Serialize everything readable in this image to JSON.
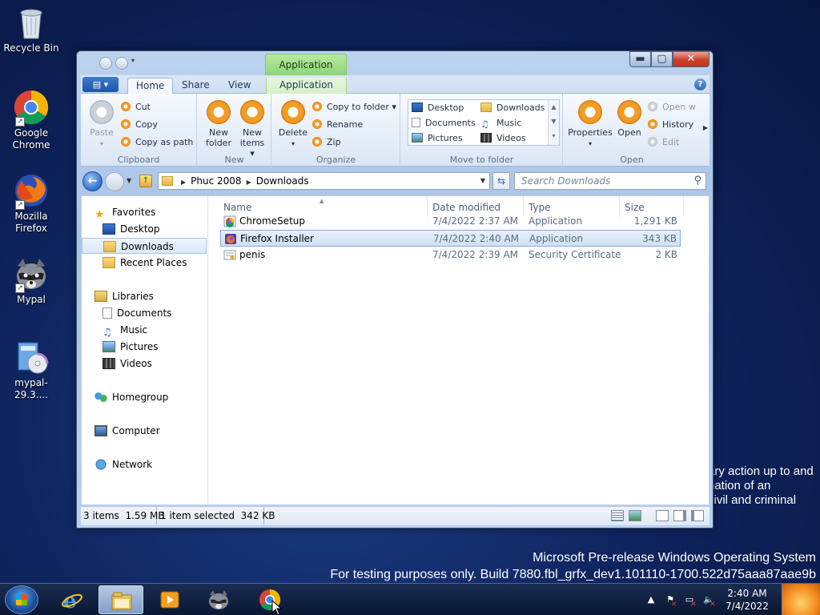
{
  "desktop": {
    "icons": [
      {
        "label": "Recycle Bin",
        "icon": "recycle-bin-icon"
      },
      {
        "label": "Google Chrome",
        "icon": "chrome-icon"
      },
      {
        "label": "Mozilla Firefox",
        "icon": "firefox-icon"
      },
      {
        "label": "Mypal",
        "icon": "mypal-icon"
      },
      {
        "label": "mypal-29.3....",
        "icon": "installer-icon"
      }
    ],
    "dialog_fragment": [
      "ary action up to and",
      "nation of an",
      "civil and criminal"
    ],
    "watermark": [
      "Microsoft Pre-release Windows Operating System",
      "For testing purposes only. Build 7880.fbl_grfx_dev1.101110-1700.522d75aaa87aae9b"
    ]
  },
  "window": {
    "contextual_tab_group": "Application Tools",
    "file_button": "▤ ▾",
    "tabs": [
      "Home",
      "Share",
      "View",
      "Application"
    ],
    "active_tab": "Home",
    "buttons": {
      "minimize": "▬",
      "maximize": "▢",
      "close": "✕"
    }
  },
  "ribbon": {
    "clipboard": {
      "label": "Clipboard",
      "paste": "Paste",
      "cut": "Cut",
      "copy": "Copy",
      "copy_as_path": "Copy as path"
    },
    "new": {
      "label": "New",
      "new_folder": "New folder",
      "new_items": "New items ▾"
    },
    "organize": {
      "label": "Organize",
      "delete": "Delete",
      "copy_to_folder": "Copy to folder ▾",
      "rename": "Rename",
      "zip": "Zip"
    },
    "move_to_folder": {
      "label": "Move to folder",
      "items": [
        "Desktop",
        "Downloads",
        "Documents",
        "Music",
        "Pictures",
        "Videos"
      ]
    },
    "open": {
      "label": "Open",
      "properties": "Properties",
      "open": "Open",
      "open_with": "Open w",
      "history": "History",
      "edit": "Edit"
    }
  },
  "address": {
    "path": [
      "Phuc 2008",
      "Downloads"
    ],
    "search_placeholder": "Search Downloads"
  },
  "navigation": {
    "favorites": {
      "label": "Favorites",
      "items": [
        "Desktop",
        "Downloads",
        "Recent Places"
      ]
    },
    "libraries": {
      "label": "Libraries",
      "items": [
        "Documents",
        "Music",
        "Pictures",
        "Videos"
      ]
    },
    "homegroup": "Homegroup",
    "computer": "Computer",
    "network": "Network",
    "selected": "Downloads"
  },
  "files": {
    "columns": [
      "Name",
      "Date modified",
      "Type",
      "Size"
    ],
    "rows": [
      {
        "name": "ChromeSetup",
        "date": "7/4/2022 2:37 AM",
        "type": "Application",
        "size": "1,291 KB",
        "icon": "chrome-setup-icon"
      },
      {
        "name": "Firefox Installer",
        "date": "7/4/2022 2:40 AM",
        "type": "Application",
        "size": "343 KB",
        "icon": "firefox-installer-icon",
        "selected": true
      },
      {
        "name": "penis",
        "date": "7/4/2022 2:39 AM",
        "type": "Security Certificate",
        "size": "2 KB",
        "icon": "certificate-icon"
      }
    ]
  },
  "status": {
    "items_count": "3 items",
    "total_size": "1.59 MB",
    "selection": "1 item selected",
    "selection_size": "342 KB"
  },
  "taskbar": {
    "clock_time": "2:40 AM",
    "clock_date": "7/4/2022",
    "pinned": [
      "internet-explorer-icon",
      "explorer-icon",
      "media-player-icon",
      "mypal-icon",
      "chrome-icon"
    ],
    "active": "explorer-icon"
  }
}
